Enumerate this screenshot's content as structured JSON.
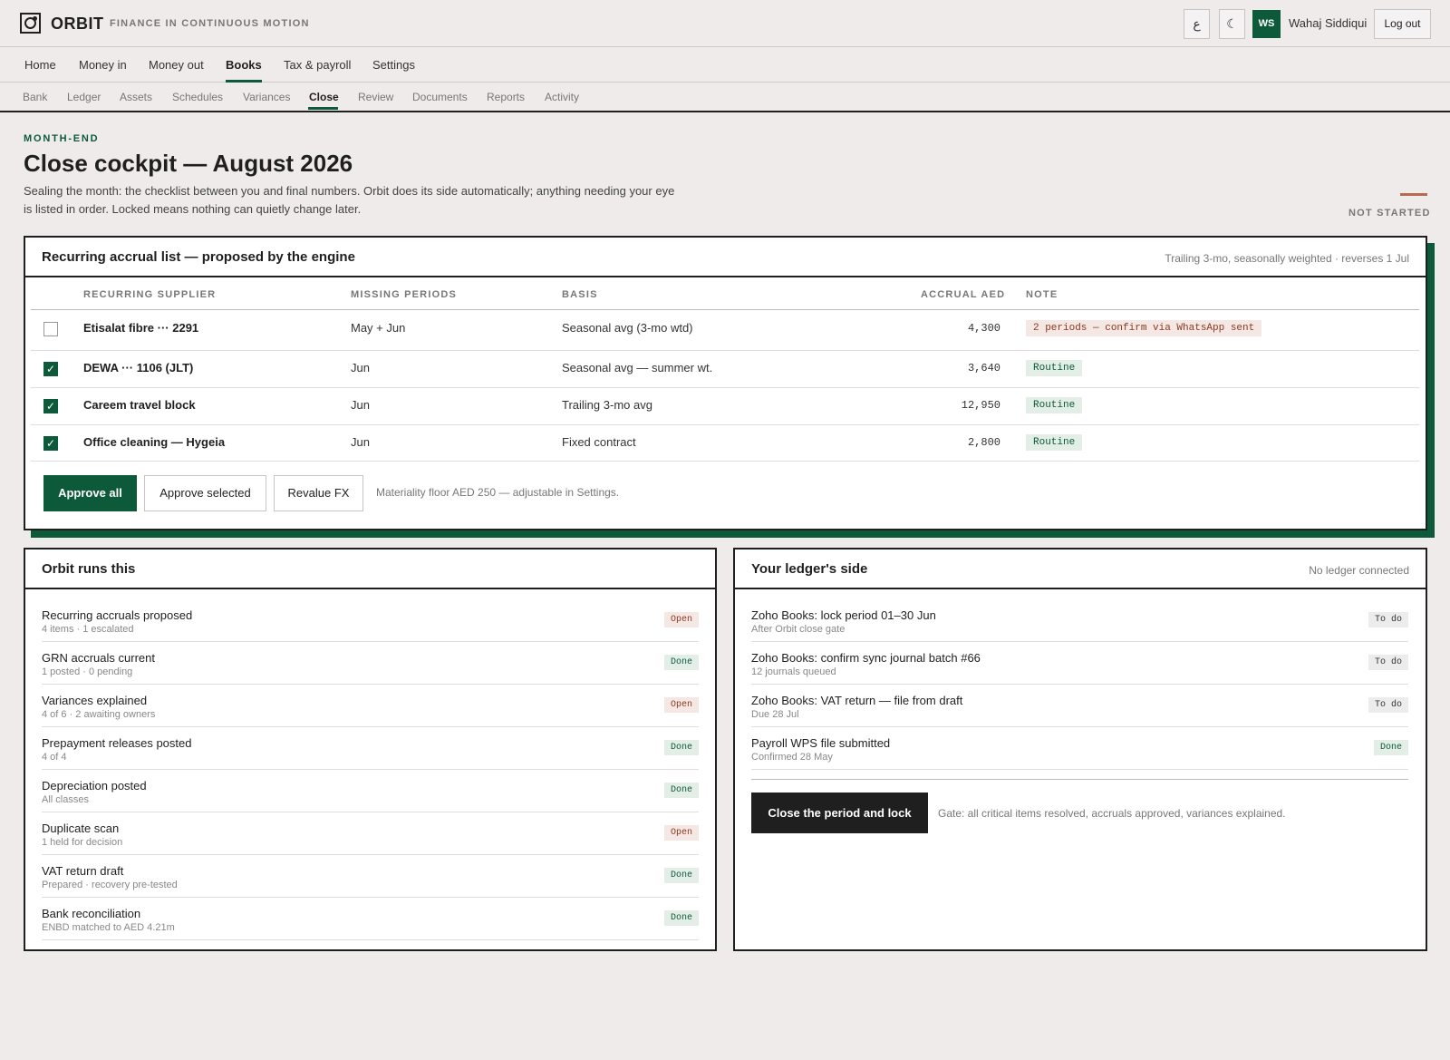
{
  "app": {
    "brand": "ORBIT",
    "tagline": "FINANCE IN CONTINUOUS MOTION",
    "lang_glyph": "ع",
    "theme_glyph": "☾",
    "user_initials": "WS",
    "user_name": "Wahaj Siddiqui",
    "logout_label": "Log out"
  },
  "main_nav": [
    "Home",
    "Money in",
    "Money out",
    "Books",
    "Tax & payroll",
    "Settings"
  ],
  "main_nav_active": "Books",
  "sub_nav": [
    "Bank",
    "Ledger",
    "Assets",
    "Schedules",
    "Variances",
    "Close",
    "Review",
    "Documents",
    "Reports",
    "Activity"
  ],
  "sub_nav_active": "Close",
  "page": {
    "eyebrow": "MONTH-END",
    "title": "Close cockpit — August 2026",
    "description": "Sealing the month: the checklist between you and final numbers. Orbit does its side automatically; anything needing your eye is listed in order. Locked means nothing can quietly change later.",
    "status": "NOT STARTED"
  },
  "accruals": {
    "title": "Recurring accrual list — proposed by the engine",
    "meta": "Trailing 3-mo, seasonally weighted · reverses 1 Jul",
    "columns": {
      "supplier": "RECURRING SUPPLIER",
      "periods": "MISSING PERIODS",
      "basis": "BASIS",
      "accrual": "ACCRUAL AED",
      "note": "NOTE"
    },
    "rows": [
      {
        "checked": false,
        "supplier": "Etisalat fibre ··· 2291",
        "periods": "May + Jun",
        "basis": "Seasonal avg (3-mo wtd)",
        "accrual": "4,300",
        "note": "2 periods — confirm via WhatsApp sent",
        "note_kind": "warn"
      },
      {
        "checked": true,
        "supplier": "DEWA ··· 1106 (JLT)",
        "periods": "Jun",
        "basis": "Seasonal avg — summer wt.",
        "accrual": "3,640",
        "note": "Routine",
        "note_kind": "ok"
      },
      {
        "checked": true,
        "supplier": "Careem travel block",
        "periods": "Jun",
        "basis": "Trailing 3-mo avg",
        "accrual": "12,950",
        "note": "Routine",
        "note_kind": "ok"
      },
      {
        "checked": true,
        "supplier": "Office cleaning — Hygeia",
        "periods": "Jun",
        "basis": "Fixed contract",
        "accrual": "2,800",
        "note": "Routine",
        "note_kind": "ok"
      }
    ],
    "approve_all_label": "Approve all",
    "approve_selected_label": "Approve selected",
    "revalue_label": "Revalue FX",
    "footnote": "Materiality floor AED 250 — adjustable in Settings."
  },
  "orbit_side": {
    "title": "Orbit runs this",
    "items": [
      {
        "title": "Recurring accruals proposed",
        "sub": "4 items · 1 escalated",
        "status": "Open"
      },
      {
        "title": "GRN accruals current",
        "sub": "1 posted · 0 pending",
        "status": "Done"
      },
      {
        "title": "Variances explained",
        "sub": "4 of 6 · 2 awaiting owners",
        "status": "Open"
      },
      {
        "title": "Prepayment releases posted",
        "sub": "4 of 4",
        "status": "Done"
      },
      {
        "title": "Depreciation posted",
        "sub": "All classes",
        "status": "Done"
      },
      {
        "title": "Duplicate scan",
        "sub": "1 held for decision",
        "status": "Open"
      },
      {
        "title": "VAT return draft",
        "sub": "Prepared · recovery pre-tested",
        "status": "Done"
      },
      {
        "title": "Bank reconciliation",
        "sub": "ENBD matched to AED 4.21m",
        "status": "Done"
      }
    ]
  },
  "ledger_side": {
    "title": "Your ledger's side",
    "meta": "No ledger connected",
    "items": [
      {
        "title": "Zoho Books: lock period 01–30 Jun",
        "sub": "After Orbit close gate",
        "status": "To do"
      },
      {
        "title": "Zoho Books: confirm sync journal batch #66",
        "sub": "12 journals queued",
        "status": "To do"
      },
      {
        "title": "Zoho Books: VAT return — file from draft",
        "sub": "Due 28 Jul",
        "status": "To do"
      },
      {
        "title": "Payroll WPS file submitted",
        "sub": "Confirmed 28 May",
        "status": "Done"
      }
    ],
    "close_label": "Close the period and lock",
    "gate_note": "Gate: all critical items resolved, accruals approved, variances explained."
  },
  "colors": {
    "accent": "#0d5a3b",
    "background": "#efebea",
    "warn_text": "#8a3a1f",
    "status_dash": "#b86a4c"
  }
}
